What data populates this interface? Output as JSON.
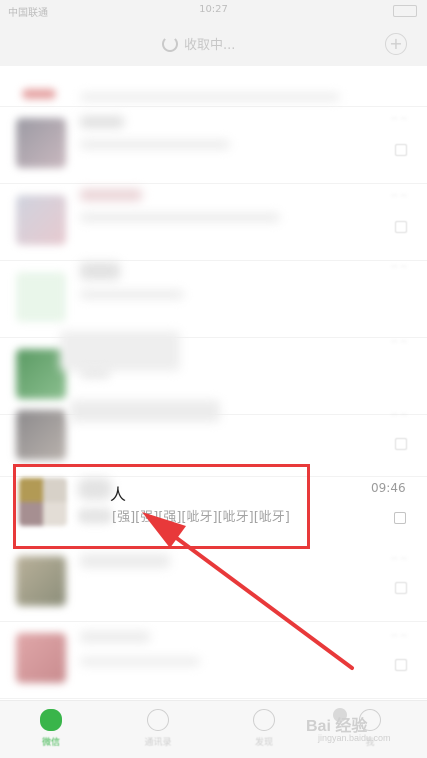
{
  "status_bar": {
    "carrier": "中国联通",
    "time": "10:27"
  },
  "header": {
    "title": "收取中..."
  },
  "highlighted_chat": {
    "title": "人",
    "time": "09:46",
    "preview": "[强][强][强][呲牙][呲牙][呲牙]"
  },
  "tabbar": {
    "tabs": [
      {
        "label": "微信",
        "icon": "chat-icon"
      },
      {
        "label": "通讯录",
        "icon": "contacts-icon"
      },
      {
        "label": "发现",
        "icon": "discover-icon"
      },
      {
        "label": "我",
        "icon": "me-icon"
      }
    ]
  },
  "watermark": {
    "brand": "Bai 经验",
    "url": "jingyan.baidu.com"
  },
  "colors": {
    "highlight": "#e8393a",
    "accent": "#39b54a"
  }
}
